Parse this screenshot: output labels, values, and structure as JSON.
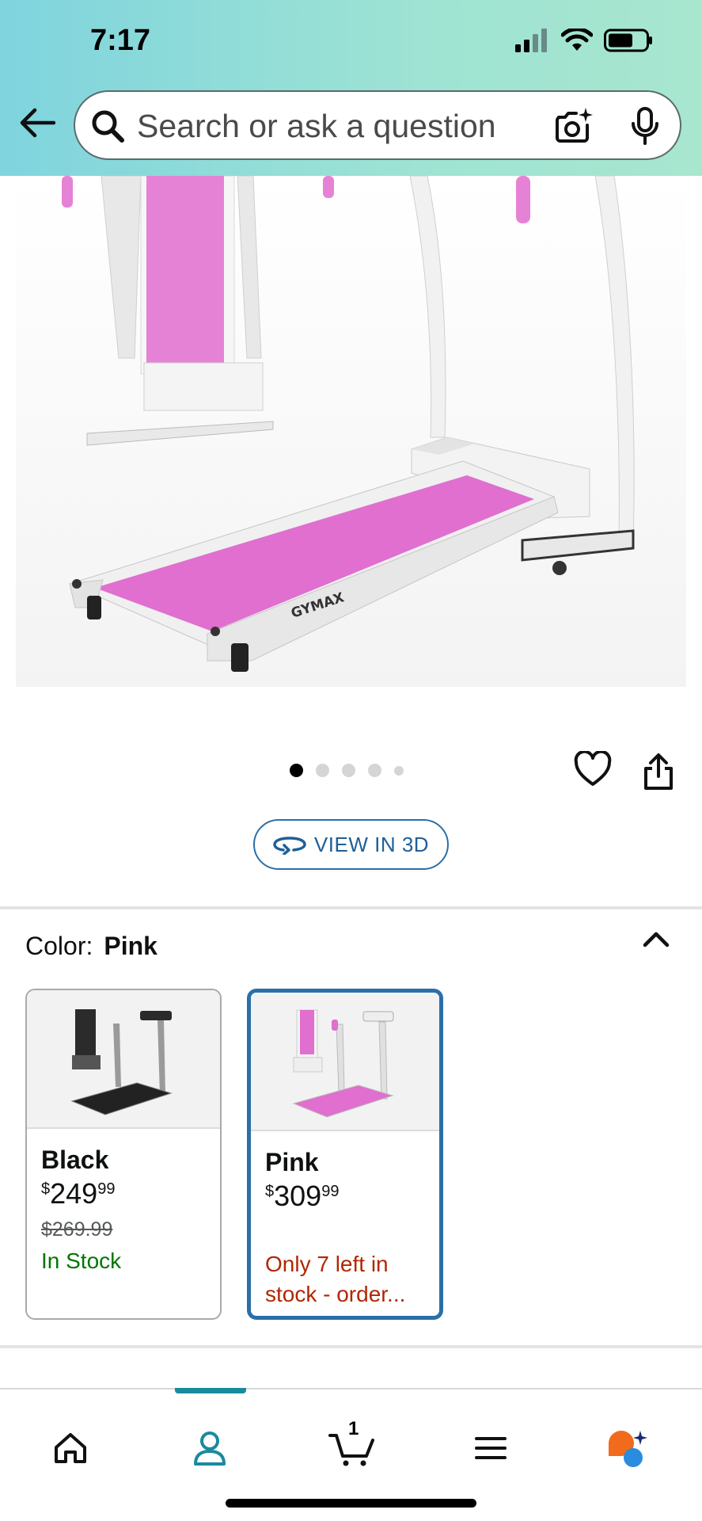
{
  "status": {
    "time": "7:17"
  },
  "search": {
    "placeholder": "Search or ask a question"
  },
  "product": {
    "image_brand": "GYMAX",
    "carousel_count": 5,
    "carousel_active": 1,
    "view_3d_label": "VIEW IN 3D"
  },
  "color": {
    "label": "Color:",
    "selected": "Pink",
    "options": [
      {
        "name": "Black",
        "price_symbol": "$",
        "price_whole": "249",
        "price_fraction": "99",
        "list_price": "$269.99",
        "availability": "In Stock"
      },
      {
        "name": "Pink",
        "price_symbol": "$",
        "price_whole": "309",
        "price_fraction": "99",
        "availability": "Only 7 left in stock - order..."
      }
    ]
  },
  "nav": {
    "cart_count": "1",
    "active": "account"
  },
  "colors": {
    "header_start": "#7fd4de",
    "header_end": "#a8e6cf",
    "accent_blue": "#2a6fa8",
    "in_stock_green": "#007600",
    "low_stock_red": "#b12704",
    "belt_pink": "#e06fcf"
  }
}
